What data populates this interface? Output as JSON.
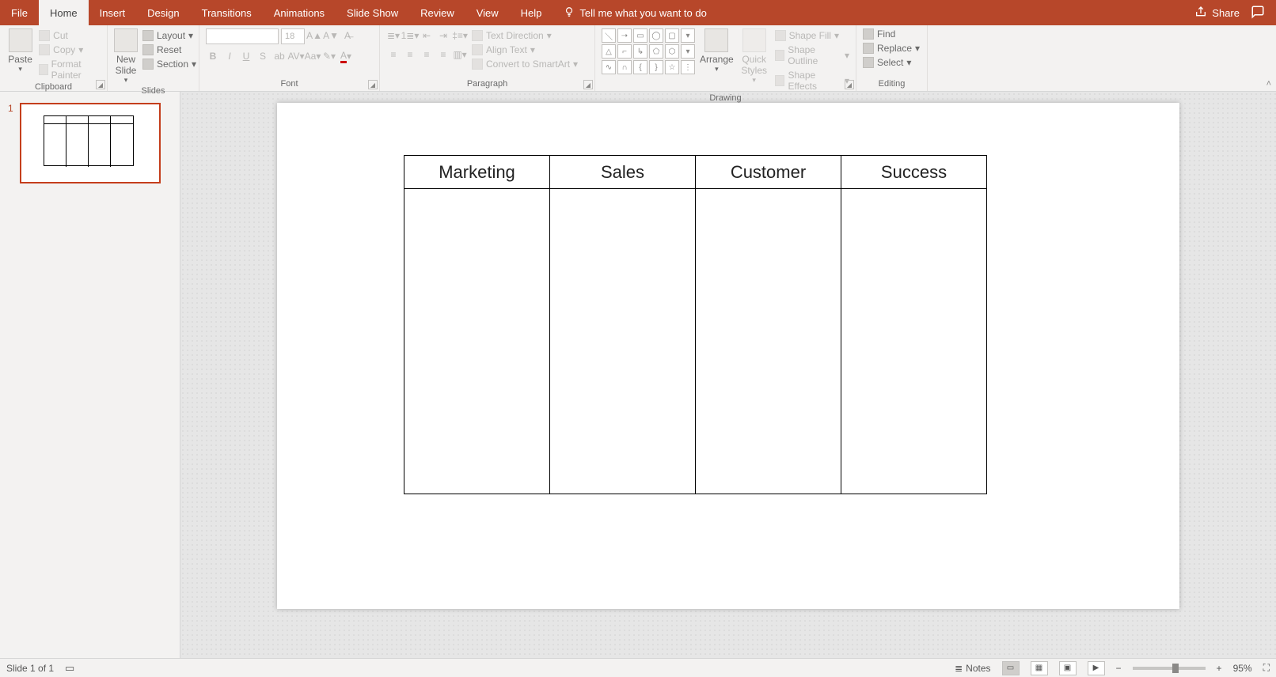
{
  "menu": {
    "tabs": [
      "File",
      "Home",
      "Insert",
      "Design",
      "Transitions",
      "Animations",
      "Slide Show",
      "Review",
      "View",
      "Help"
    ],
    "active": "Home",
    "tell_me": "Tell me what you want to do",
    "share": "Share"
  },
  "ribbon": {
    "clipboard": {
      "paste": "Paste",
      "cut": "Cut",
      "copy": "Copy",
      "format_painter": "Format Painter",
      "label": "Clipboard"
    },
    "slides": {
      "new_slide": "New\nSlide",
      "layout": "Layout",
      "reset": "Reset",
      "section": "Section",
      "label": "Slides"
    },
    "font": {
      "name_placeholder": "",
      "size": "18",
      "label": "Font"
    },
    "paragraph": {
      "text_direction": "Text Direction",
      "align_text": "Align Text",
      "convert_smartart": "Convert to SmartArt",
      "label": "Paragraph"
    },
    "drawing": {
      "arrange": "Arrange",
      "quick_styles": "Quick\nStyles",
      "shape_fill": "Shape Fill",
      "shape_outline": "Shape Outline",
      "shape_effects": "Shape Effects",
      "label": "Drawing"
    },
    "editing": {
      "find": "Find",
      "replace": "Replace",
      "select": "Select",
      "label": "Editing"
    }
  },
  "thumb": {
    "number": "1"
  },
  "table": {
    "headers": [
      "Marketing",
      "Sales",
      "Customer",
      "Success"
    ]
  },
  "status": {
    "slide": "Slide 1 of 1",
    "notes": "Notes",
    "zoom": "95%"
  }
}
